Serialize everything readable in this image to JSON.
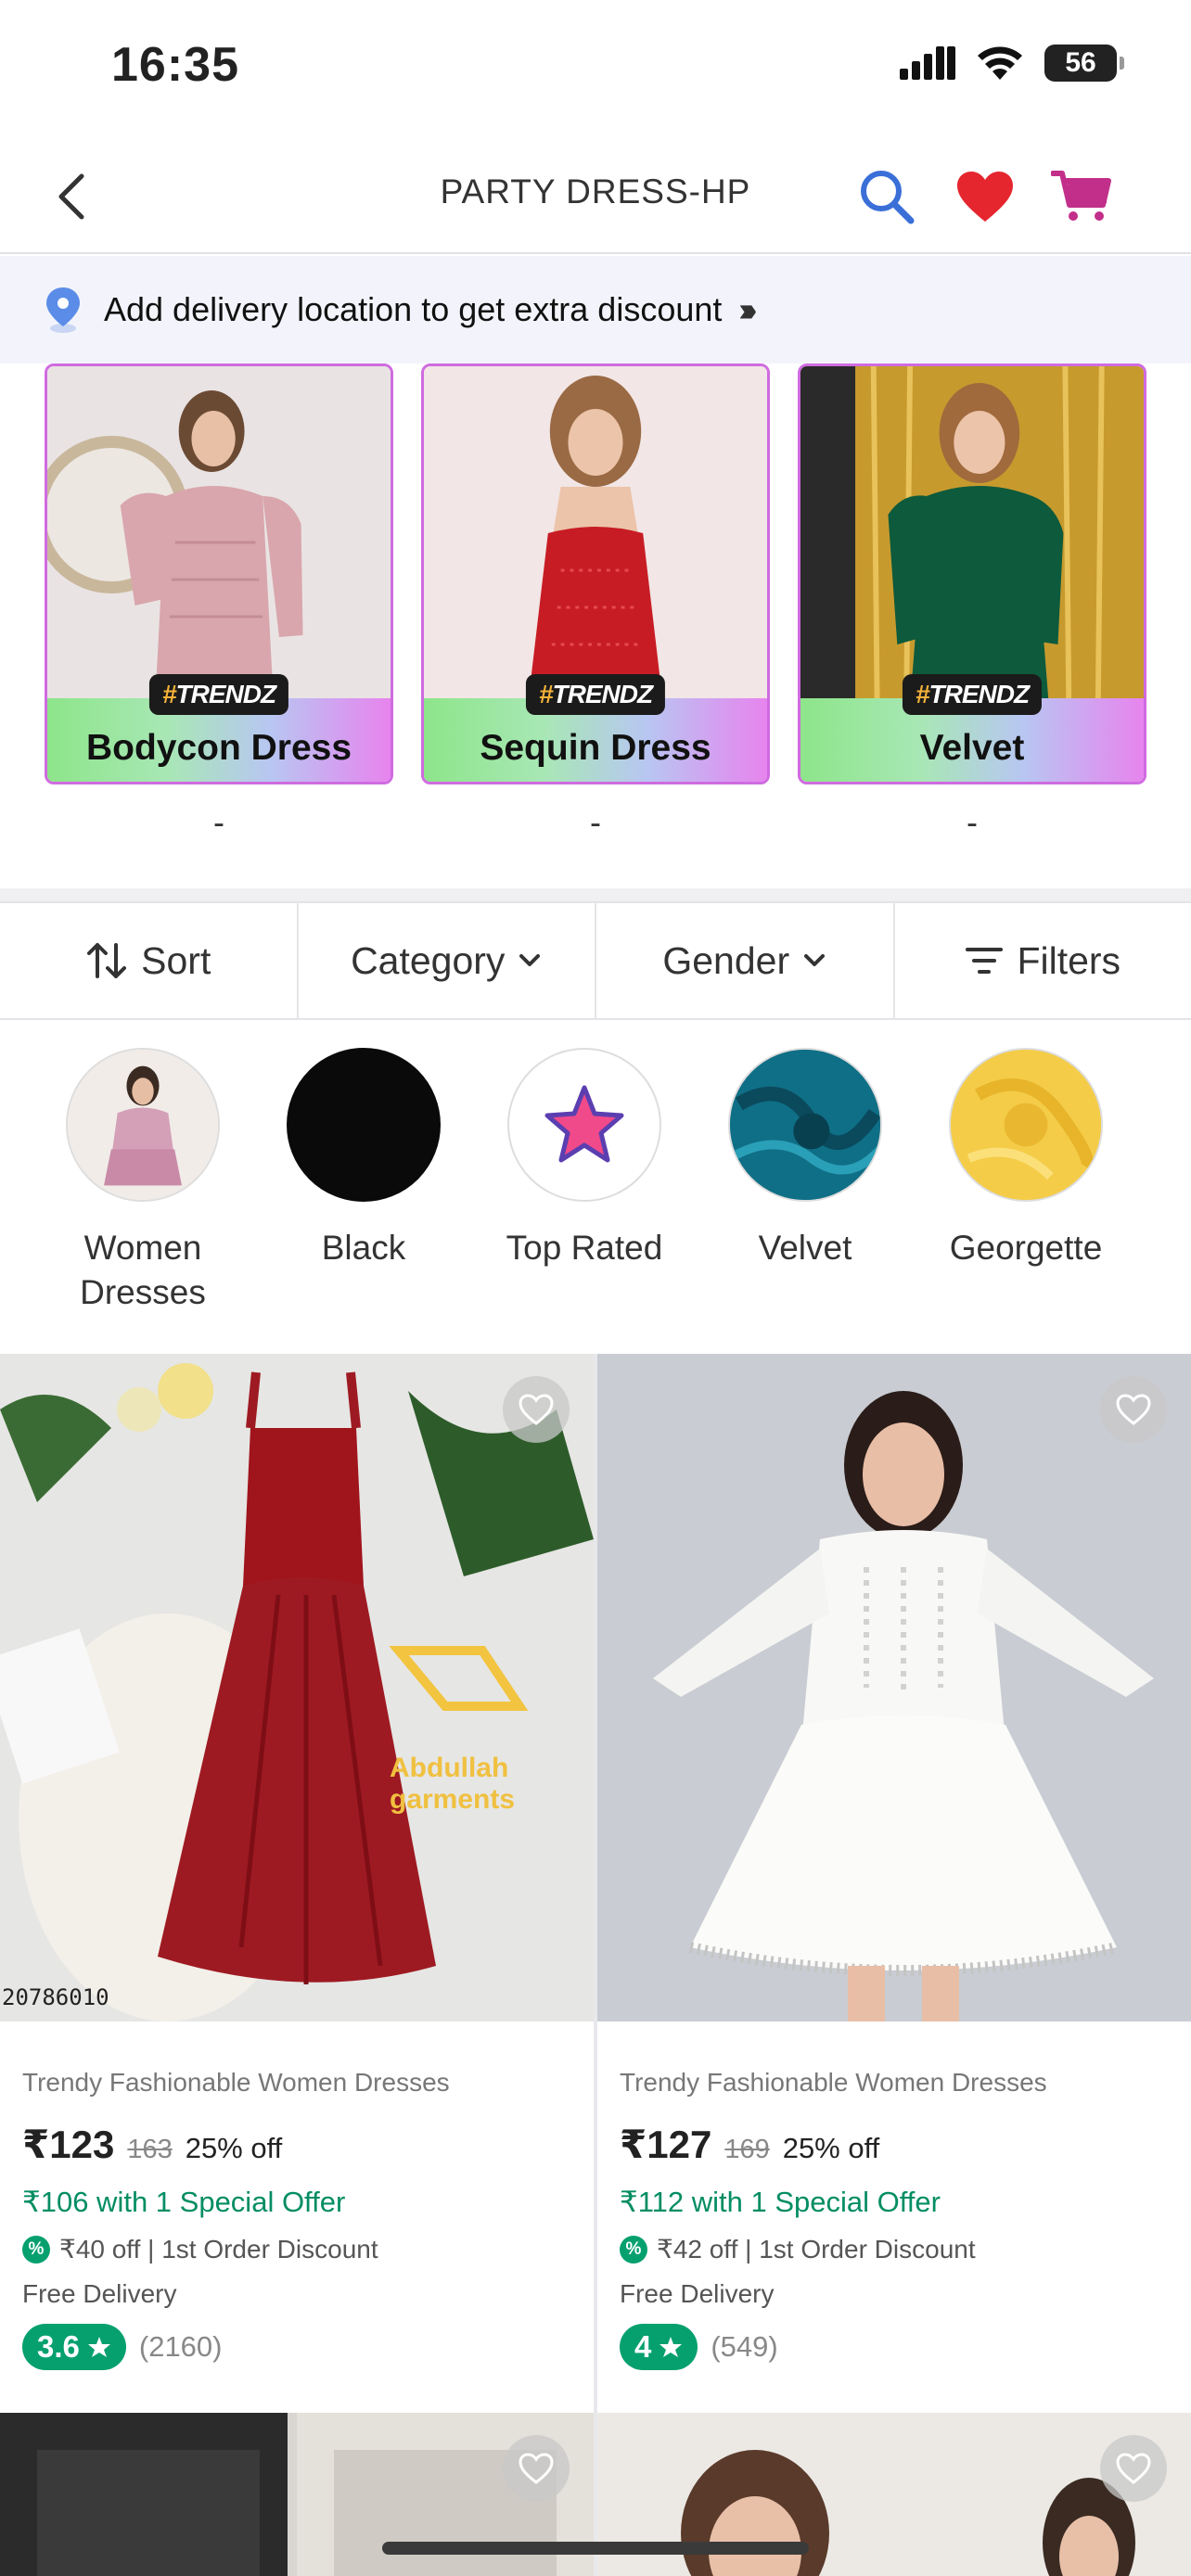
{
  "status": {
    "time": "16:35",
    "battery": "56"
  },
  "header": {
    "title": "PARTY DRESS-HP"
  },
  "delivery": {
    "text": "Add delivery location to get extra discount"
  },
  "trends": [
    {
      "tag_hash": "#",
      "tag": "TRENDZ",
      "name": "Bodycon Dress",
      "sub": "-"
    },
    {
      "tag_hash": "#",
      "tag": "TRENDZ",
      "name": "Sequin Dress",
      "sub": "-"
    },
    {
      "tag_hash": "#",
      "tag": "TRENDZ",
      "name": "Velvet",
      "sub": "-"
    }
  ],
  "filters": {
    "sort": "Sort",
    "category": "Category",
    "gender": "Gender",
    "filters": "Filters"
  },
  "chips": [
    {
      "label": "Women\nDresses"
    },
    {
      "label": "Black"
    },
    {
      "label": "Top Rated"
    },
    {
      "label": "Velvet"
    },
    {
      "label": "Georgette"
    }
  ],
  "products": [
    {
      "image_text": "20786010",
      "watermark": "Abdullah garments",
      "name": "Trendy Fashionable Women Dresses",
      "price": "₹123",
      "mrp": "163",
      "off": "25% off",
      "offer": "₹106 with 1 Special Offer",
      "discount": "₹40 off | 1st Order Discount",
      "delivery": "Free Delivery",
      "rating": "3.6",
      "rating_count": "(2160)"
    },
    {
      "name": "Trendy Fashionable Women Dresses",
      "price": "₹127",
      "mrp": "169",
      "off": "25% off",
      "offer": "₹112 with 1 Special Offer",
      "discount": "₹42 off | 1st Order Discount",
      "delivery": "Free Delivery",
      "rating": "4",
      "rating_count": "(549)"
    }
  ]
}
